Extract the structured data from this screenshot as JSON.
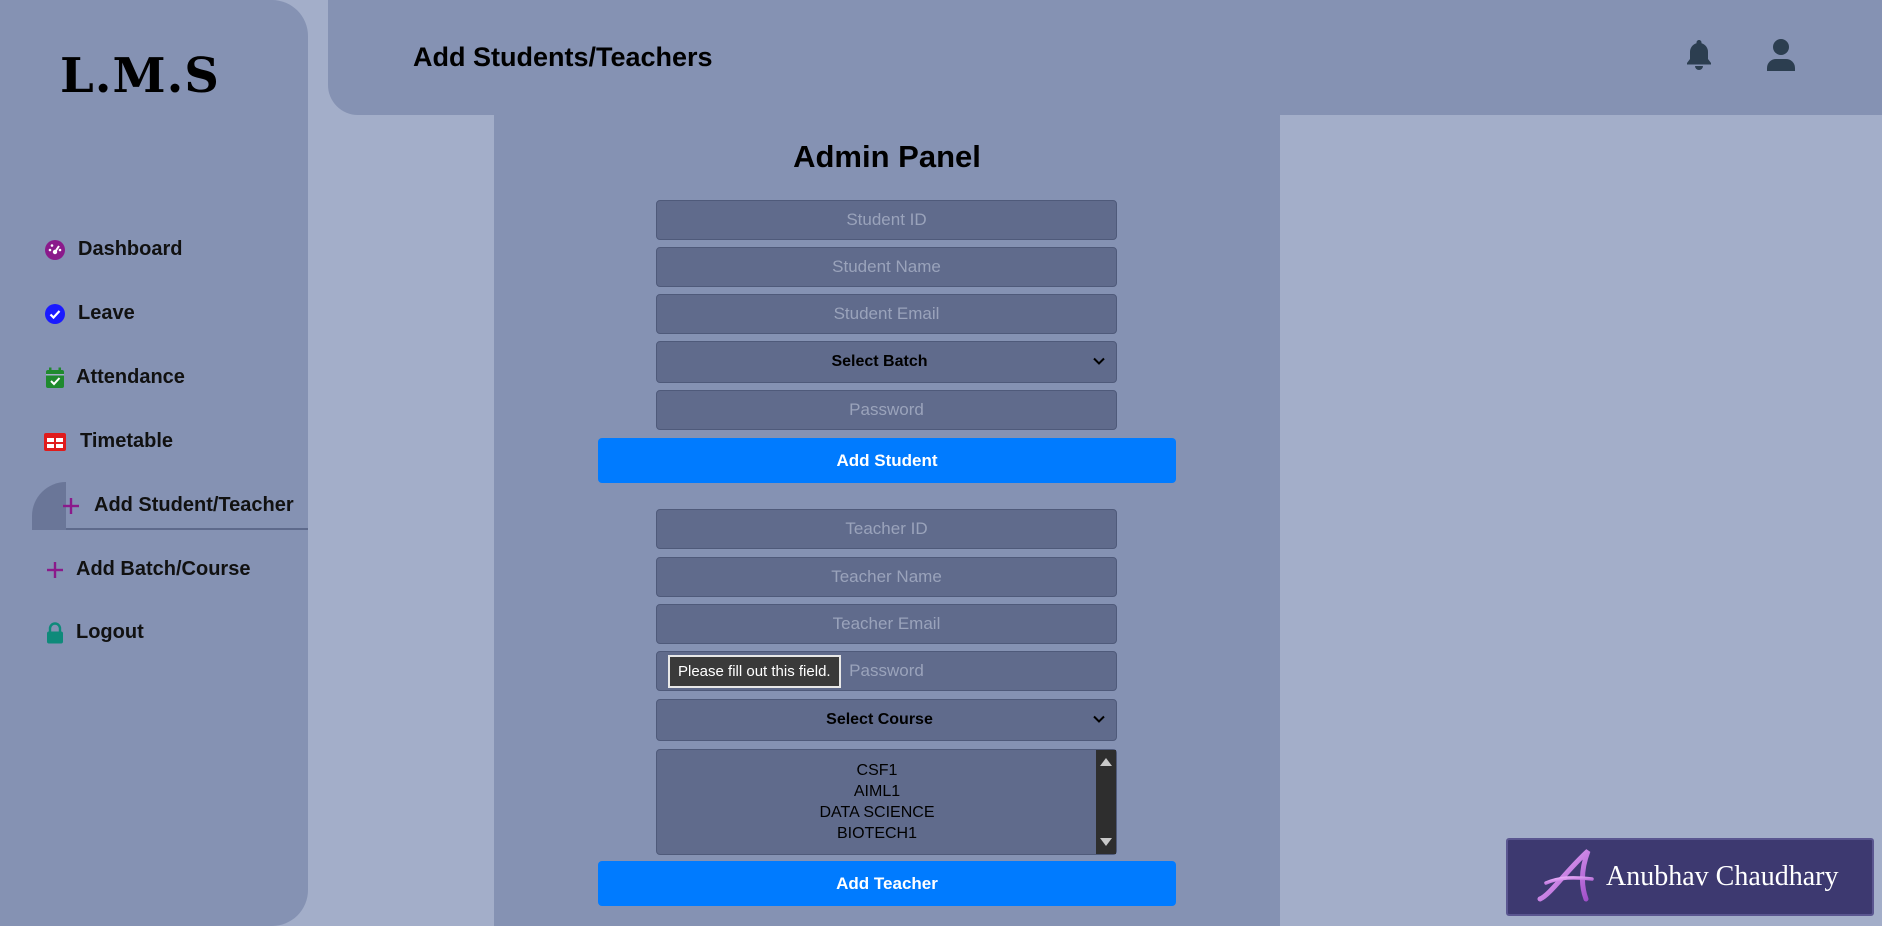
{
  "sidebar": {
    "logo": "L.M.S",
    "items": [
      {
        "label": "Dashboard",
        "icon": "dashboard-gauge-icon",
        "color": "#8b1a8b"
      },
      {
        "label": "Leave",
        "icon": "check-circle-icon",
        "color": "#1a1aff"
      },
      {
        "label": "Attendance",
        "icon": "calendar-check-icon",
        "color": "#1f8a2e"
      },
      {
        "label": "Timetable",
        "icon": "table-icon",
        "color": "#e01b1b"
      },
      {
        "label": "Add Student/Teacher",
        "icon": "plus-icon",
        "color": "#8b1a8b",
        "active": true
      },
      {
        "label": "Add Batch/Course",
        "icon": "plus-icon",
        "color": "#8b1a8b"
      },
      {
        "label": "Logout",
        "icon": "lock-icon",
        "color": "#0e8a7a"
      }
    ]
  },
  "header": {
    "title": "Add Students/Teachers",
    "icons": [
      "bell-icon",
      "user-icon"
    ]
  },
  "panel": {
    "title": "Admin Panel",
    "student_form": {
      "id_placeholder": "Student ID",
      "name_placeholder": "Student Name",
      "email_placeholder": "Student Email",
      "batch_select": "Select Batch",
      "password_placeholder": "Password",
      "submit": "Add Student"
    },
    "teacher_form": {
      "id_placeholder": "Teacher ID",
      "name_placeholder": "Teacher Name",
      "email_placeholder": "Teacher Email",
      "password_placeholder": "Password",
      "course_select": "Select Course",
      "batch_options": [
        "CSF1",
        "AIML1",
        "DATA SCIENCE",
        "BIOTECH1"
      ],
      "submit": "Add Teacher"
    },
    "validation_tooltip": "Please fill out this field."
  },
  "watermark": {
    "name": "Anubhav Chaudhary"
  },
  "colors": {
    "accent": "#007bff",
    "background": "#a3aec9",
    "surface": "#8592b3",
    "input": "#606b8c"
  }
}
